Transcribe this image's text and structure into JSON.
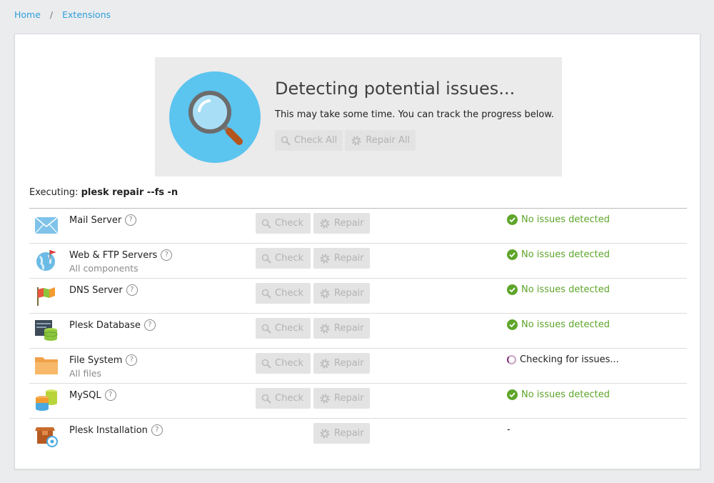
{
  "breadcrumb": {
    "home": "Home",
    "sep": "/",
    "current": "Extensions"
  },
  "banner": {
    "title": "Detecting potential issues...",
    "subtitle": "This may take some time. You can track the progress below.",
    "check_all": "Check All",
    "repair_all": "Repair All"
  },
  "executing": {
    "label": "Executing:",
    "command": "plesk repair --fs -n"
  },
  "common": {
    "check": "Check",
    "repair": "Repair",
    "help": "?"
  },
  "rows": [
    {
      "name": "Mail Server",
      "sub": "",
      "status": "No issues detected"
    },
    {
      "name": "Web & FTP Servers",
      "sub": "All components",
      "status": "No issues detected"
    },
    {
      "name": "DNS Server",
      "sub": "",
      "status": "No issues detected"
    },
    {
      "name": "Plesk Database",
      "sub": "",
      "status": "No issues detected"
    },
    {
      "name": "File System",
      "sub": "All files",
      "status": "Checking for issues..."
    },
    {
      "name": "MySQL",
      "sub": "",
      "status": "No issues detected"
    },
    {
      "name": "Plesk Installation",
      "sub": "",
      "status": "-"
    }
  ],
  "colors": {
    "accent": "#2d9fd9",
    "ok": "#5ea52a",
    "banner_circle": "#5bc4ef"
  }
}
